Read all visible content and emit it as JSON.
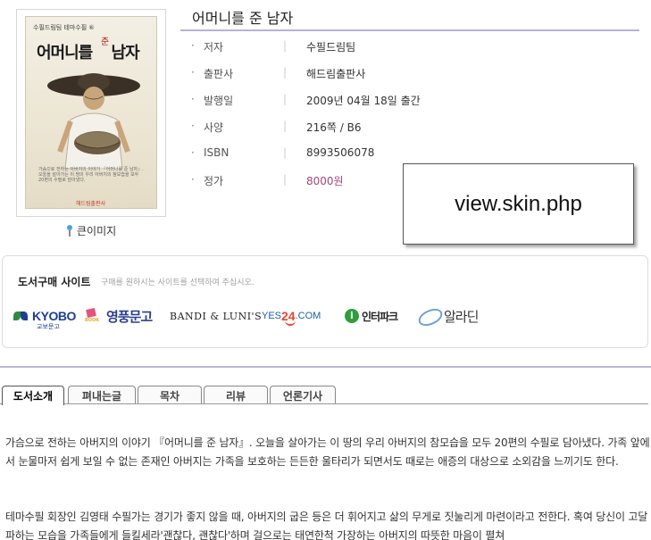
{
  "cover": {
    "series_label": "수필드림팀 테마수필 ⑥",
    "title_main": "어머니를",
    "title_accent": "준",
    "title_end": "남자",
    "blurb": "가슴으로 전하는 아버지의 이야기 『어머니를 준 남자』. 오늘을 살아가는 이 땅의 우리 아버지의 참모습을 모두 20편의 수필로 담아냈다.",
    "publisher": "해드림출판사"
  },
  "zoom_label": "큰이미지",
  "book": {
    "title": "어머니를 준 남자",
    "info": [
      {
        "label": "저자",
        "value": "수필드림팀"
      },
      {
        "label": "출판사",
        "value": "해드림출판사"
      },
      {
        "label": "발행일",
        "value": "2009년 04월 18일 출간"
      },
      {
        "label": "사양",
        "value": "216쪽 / B6"
      },
      {
        "label": "ISBN",
        "value": "8993506078"
      },
      {
        "label": "정가",
        "value": "8000원"
      }
    ],
    "price_color": "#a1477d"
  },
  "overlay_label": "view.skin.php",
  "purchase": {
    "title": "도서구매 사이트",
    "hint": "구매를 원하시는 사이트를 선택하여 주십시오.",
    "stores": {
      "kyobo": {
        "name": "KYOBO",
        "sub": "교보문고"
      },
      "youngpoong": {
        "name": "영풍문고"
      },
      "bandi": {
        "name": "BANDI & LUNI'S"
      },
      "yes24": {
        "name_pre": "YES",
        "name_num": "24",
        "name_post": ".COM"
      },
      "interpark": {
        "name": "인터파크"
      },
      "aladin": {
        "name": "알라딘"
      }
    }
  },
  "tabs": [
    "도서소개",
    "펴내는글",
    "목차",
    "리뷰",
    "언론기사"
  ],
  "active_tab": "도서소개",
  "content": {
    "p1": "가슴으로 전하는 아버지의 이야기 『어머니를 준 남자』. 오늘을 살아가는 이 땅의 우리 아버지의 참모습을 모두 20편의 수필로 담아냈다. 가족 앞에서 눈물마저 쉽게 보일 수 없는 존재인 아버지는 가족을 보호하는 든든한 울타리가 되면서도 때로는 애증의 대상으로 소외감을 느끼기도 한다.",
    "p2": "테마수필 회장인 김영태 수필가는 경기가 좋지 않을 때, 아버지의 굽은 등은 더 휘어지고 삶의 무게로 짓눌리게 마련이라고 전한다. 혹여 당신이 고달파하는 모습을 가족들에게 들킬세라'괜찮다, 괜찮다'하며 걸으로는 태연한척 가장하는 아버지의 따뜻한 마음이 펼쳐"
  },
  "colors": {
    "accent_rule": "#b9b2d8",
    "price": "#a1477d"
  }
}
